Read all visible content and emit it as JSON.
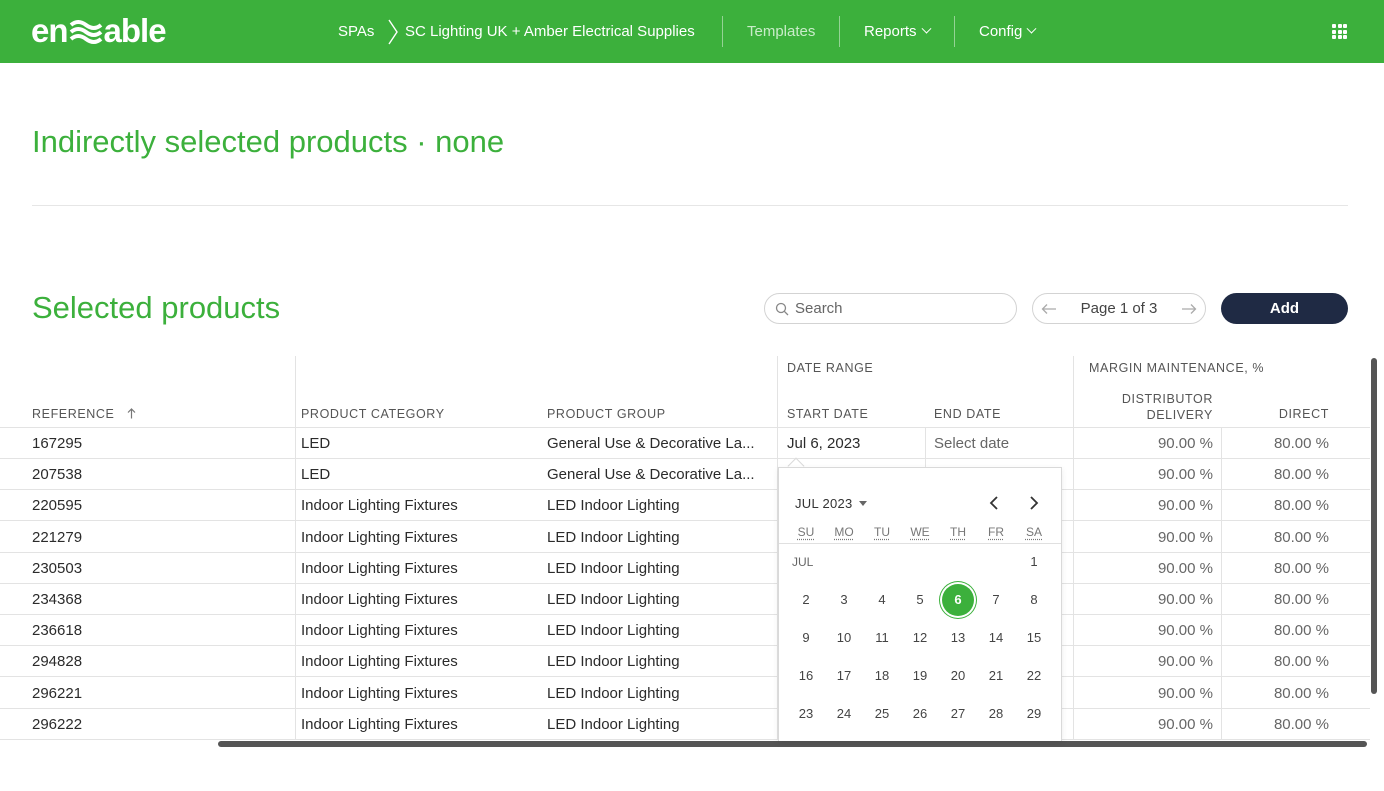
{
  "header": {
    "logo_text": "enable",
    "breadcrumb": [
      "SPAs",
      "SC Lighting UK + Amber Electrical Supplies"
    ],
    "nav": [
      {
        "label": "Templates"
      },
      {
        "label": "Reports"
      },
      {
        "label": "Config"
      }
    ]
  },
  "indirect": {
    "title": "Indirectly selected products · none"
  },
  "selected": {
    "title": "Selected products",
    "search_placeholder": "Search",
    "page_label": "Page 1 of 3",
    "add_label": "Add"
  },
  "table": {
    "group_headers": {
      "date_range": "DATE RANGE",
      "margin": "MARGIN MAINTENANCE, %"
    },
    "columns": {
      "reference": "REFERENCE",
      "category": "PRODUCT CATEGORY",
      "group": "PRODUCT GROUP",
      "start": "START DATE",
      "end": "END DATE",
      "distributor": "DISTRIBUTOR DELIVERY",
      "direct": "DIRECT"
    },
    "rows": [
      {
        "ref": "167295",
        "category": "LED",
        "group": "General Use & Decorative La...",
        "start": "Jul 6, 2023",
        "end": "Select date",
        "distributor": "90.00 %",
        "direct": "80.00 %"
      },
      {
        "ref": "207538",
        "category": "LED",
        "group": "General Use & Decorative La...",
        "start": "",
        "end": "",
        "distributor": "90.00 %",
        "direct": "80.00 %"
      },
      {
        "ref": "220595",
        "category": "Indoor Lighting Fixtures",
        "group": "LED Indoor Lighting",
        "start": "",
        "end": "",
        "distributor": "90.00 %",
        "direct": "80.00 %"
      },
      {
        "ref": "221279",
        "category": "Indoor Lighting Fixtures",
        "group": "LED Indoor Lighting",
        "start": "",
        "end": "",
        "distributor": "90.00 %",
        "direct": "80.00 %"
      },
      {
        "ref": "230503",
        "category": "Indoor Lighting Fixtures",
        "group": "LED Indoor Lighting",
        "start": "",
        "end": "",
        "distributor": "90.00 %",
        "direct": "80.00 %"
      },
      {
        "ref": "234368",
        "category": "Indoor Lighting Fixtures",
        "group": "LED Indoor Lighting",
        "start": "",
        "end": "",
        "distributor": "90.00 %",
        "direct": "80.00 %"
      },
      {
        "ref": "236618",
        "category": "Indoor Lighting Fixtures",
        "group": "LED Indoor Lighting",
        "start": "",
        "end": "",
        "distributor": "90.00 %",
        "direct": "80.00 %"
      },
      {
        "ref": "294828",
        "category": "Indoor Lighting Fixtures",
        "group": "LED Indoor Lighting",
        "start": "",
        "end": "",
        "distributor": "90.00 %",
        "direct": "80.00 %"
      },
      {
        "ref": "296221",
        "category": "Indoor Lighting Fixtures",
        "group": "LED Indoor Lighting",
        "start": "",
        "end": "",
        "distributor": "90.00 %",
        "direct": "80.00 %"
      },
      {
        "ref": "296222",
        "category": "Indoor Lighting Fixtures",
        "group": "LED Indoor Lighting",
        "start": "",
        "end": "",
        "distributor": "90.00 %",
        "direct": "80.00 %"
      }
    ]
  },
  "calendar": {
    "month_label": "JUL 2023",
    "month_short": "JUL",
    "weekdays": [
      "SU",
      "MO",
      "TU",
      "WE",
      "TH",
      "FR",
      "SA"
    ],
    "weeks": [
      [
        "",
        "",
        "",
        "",
        "",
        "",
        "1"
      ],
      [
        "2",
        "3",
        "4",
        "5",
        "6",
        "7",
        "8"
      ],
      [
        "9",
        "10",
        "11",
        "12",
        "13",
        "14",
        "15"
      ],
      [
        "16",
        "17",
        "18",
        "19",
        "20",
        "21",
        "22"
      ],
      [
        "23",
        "24",
        "25",
        "26",
        "27",
        "28",
        "29"
      ]
    ],
    "selected_day": "6"
  },
  "colors": {
    "brand_green": "#3cb03c",
    "navy": "#1f2a44"
  }
}
